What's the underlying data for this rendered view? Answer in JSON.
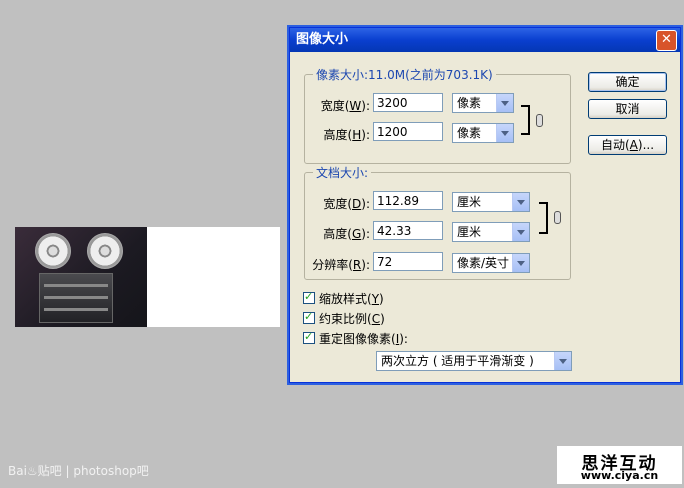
{
  "dialog": {
    "title": "图像大小",
    "pixel_group": {
      "legend": "像素大小:11.0M(之前为703.1K)",
      "width_label": "宽度(",
      "width_key": "W",
      "width_value": "3200",
      "width_unit": "像素",
      "height_label": "高度(",
      "height_key": "H",
      "height_value": "1200",
      "height_unit": "像素"
    },
    "doc_group": {
      "legend": "文档大小:",
      "width_label": "宽度(",
      "width_key": "D",
      "width_value": "112.89",
      "width_unit": "厘米",
      "height_label": "高度(",
      "height_key": "G",
      "height_value": "42.33",
      "height_unit": "厘米",
      "res_label": "分辨率(",
      "res_key": "R",
      "res_value": "72",
      "res_unit": "像素/英寸"
    },
    "buttons": {
      "ok": "确定",
      "cancel": "取消",
      "auto": "自动(",
      "auto_key": "A",
      "auto_tail": ")..."
    },
    "checkboxes": {
      "scale_styles": "缩放样式(",
      "scale_styles_key": "Y",
      "constrain": "约束比例(",
      "constrain_key": "C",
      "resample": "重定图像像素(",
      "resample_key": "I",
      "resample_tail": "):"
    },
    "resample_method": "两次立方 ( 适用于平滑渐变 )"
  },
  "watermark": {
    "text": "Bai♨贴吧 | photoshop吧"
  },
  "site_logo": {
    "main": "思洋互动",
    "sub": "www.ciya.cn"
  },
  "colors": {
    "accent": "#0a3fcf",
    "legend": "#1c47b0"
  }
}
